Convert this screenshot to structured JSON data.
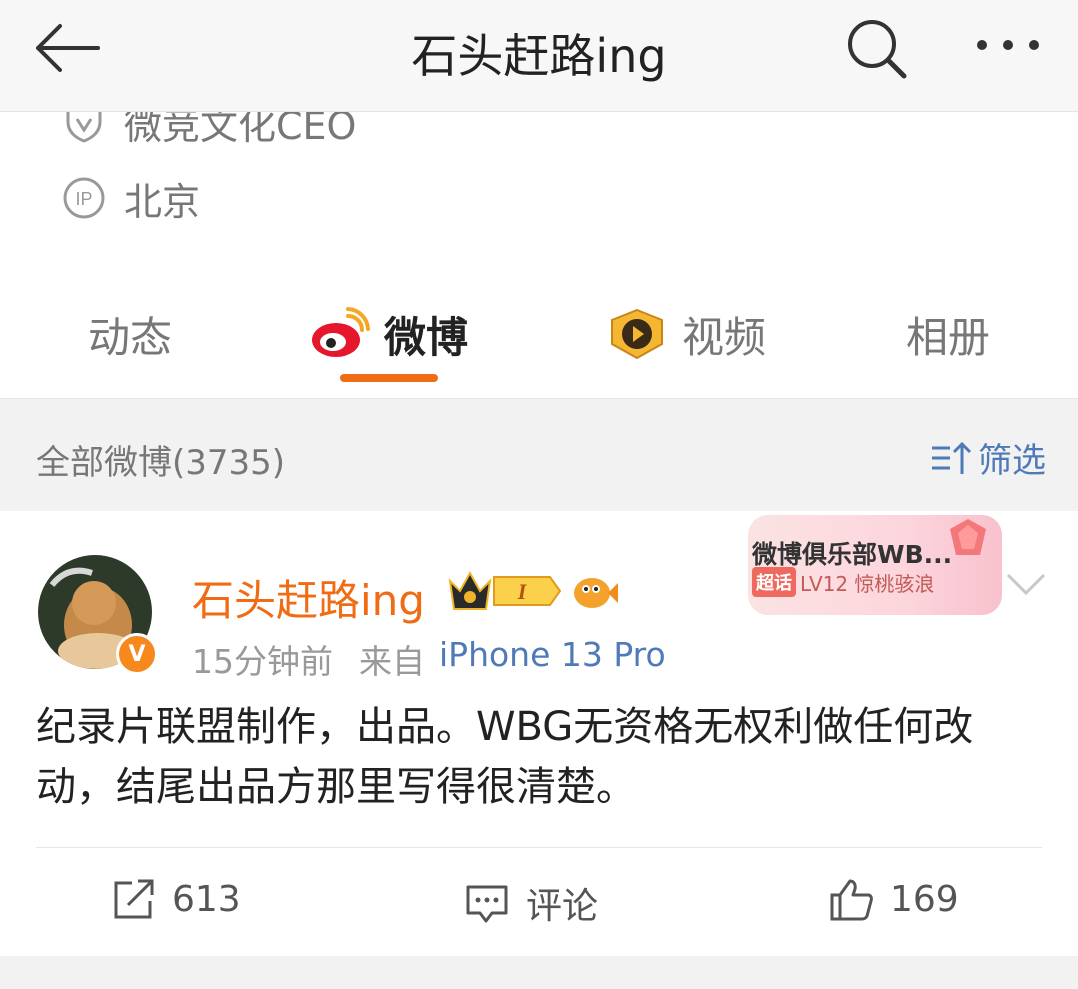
{
  "header": {
    "title": "石头赶路ing",
    "back_icon": "arrow-left-icon",
    "search_icon": "search-icon",
    "more_icon": "more-dots-icon"
  },
  "profile": {
    "company": "微竞文化CEO",
    "ip_label": "IP",
    "location": "北京"
  },
  "tabs": [
    {
      "label": "动态",
      "active": false
    },
    {
      "label": "微博",
      "active": true
    },
    {
      "label": "视频",
      "active": false
    },
    {
      "label": "相册",
      "active": false
    }
  ],
  "filter_band": {
    "all_posts": "全部微博(3735)",
    "filter_label": "筛选"
  },
  "post": {
    "username": "石头赶路ing",
    "verify_letter": "V",
    "crown_level": "I",
    "time": "15分钟前",
    "from_label": "来自",
    "source": "iPhone 13 Pro",
    "club": {
      "name": "微博俱乐部WB...",
      "tag": "超话",
      "level": "LV12 惊桃骇浪"
    },
    "text": "纪录片联盟制作，出品。WBG无资格无权利做任何改动，结尾出品方那里写得很清楚。",
    "repost_count": "613",
    "comment_label": "评论",
    "like_count": "169"
  },
  "colors": {
    "accent_orange": "#f06c14",
    "link_blue": "#4f7ab8"
  }
}
